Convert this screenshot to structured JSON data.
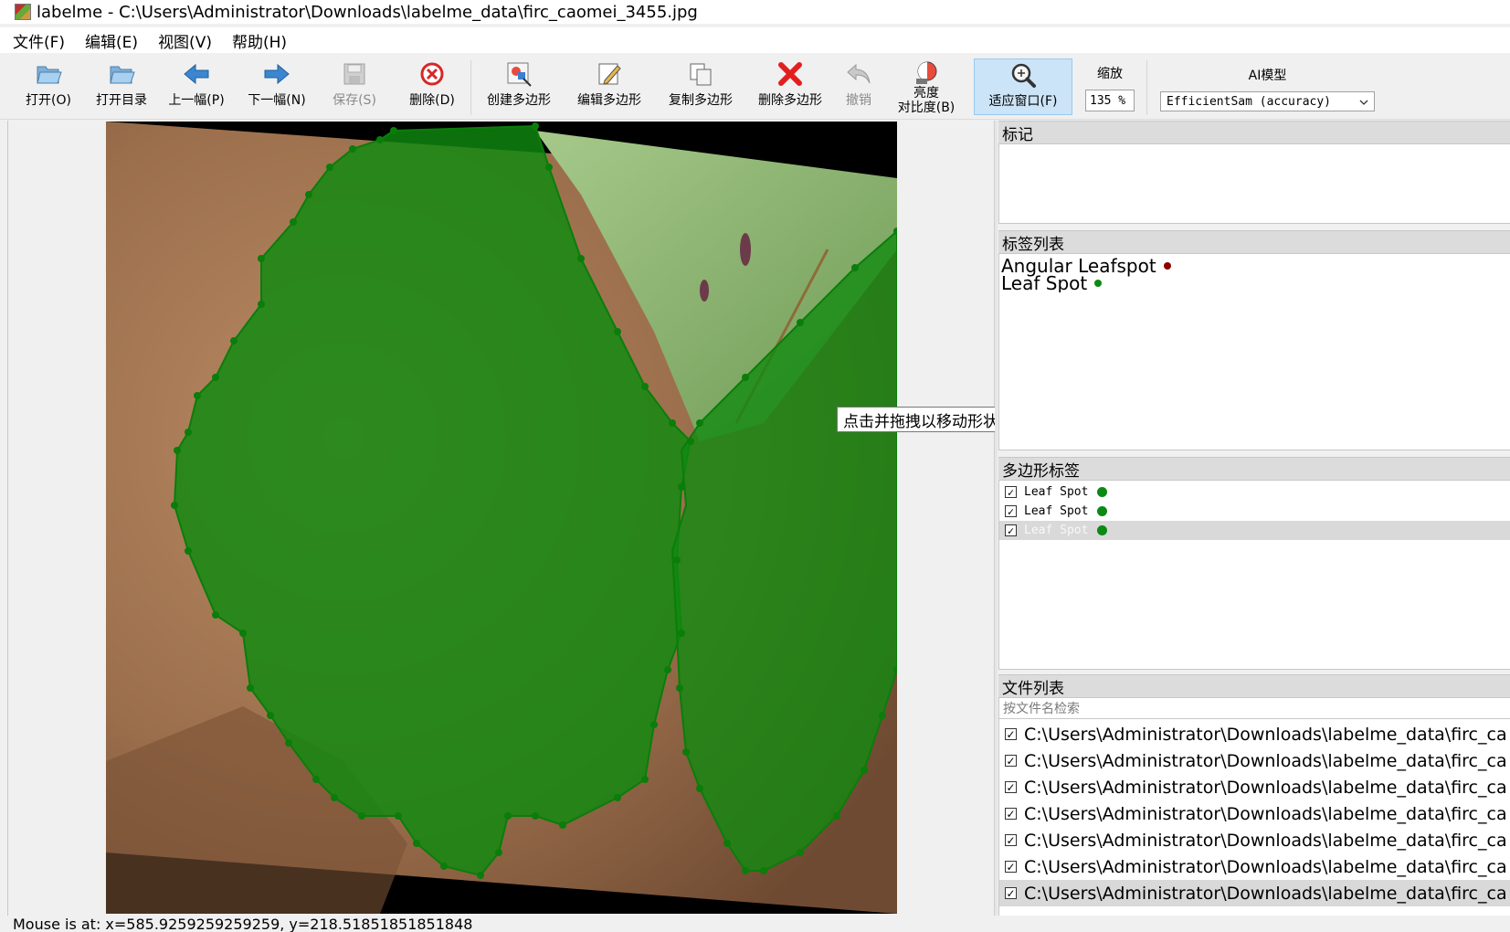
{
  "window": {
    "title": "labelme - C:\\Users\\Administrator\\Downloads\\labelme_data\\firc_caomei_3455.jpg"
  },
  "menu": [
    "文件(F)",
    "编辑(E)",
    "视图(V)",
    "帮助(H)"
  ],
  "toolbar": {
    "open": "打开(O)",
    "open_dir": "打开目录",
    "prev": "上一幅(P)",
    "next": "下一幅(N)",
    "save": "保存(S)",
    "delete": "删除(D)",
    "create_polygon": "创建多边形",
    "edit_polygon": "编辑多边形",
    "copy_polygon": "复制多边形",
    "delete_polygon": "删除多边形",
    "undo": "撤销",
    "brightness_line1": "亮度",
    "brightness_line2": "对比度(B)",
    "fit_window": "适应窗口(F)",
    "zoom_label": "缩放",
    "zoom_value": "135 %",
    "ai_label": "AI模型",
    "ai_model": "EfficientSam (accuracy)"
  },
  "canvas": {
    "tooltip": "点击并拖拽以移动形状'Leaf Spot'"
  },
  "flags_panel": {
    "title": "标记"
  },
  "label_list": {
    "title": "标签列表",
    "items": [
      {
        "name": "Angular Leafspot",
        "color": "#8b0000"
      },
      {
        "name": "Leaf Spot",
        "color": "#0a8a12"
      }
    ]
  },
  "polygon_labels": {
    "title": "多边形标签",
    "items": [
      {
        "name": "Leaf Spot",
        "checked": true,
        "selected": false
      },
      {
        "name": "Leaf Spot",
        "checked": true,
        "selected": false
      },
      {
        "name": "Leaf Spot",
        "checked": true,
        "selected": true
      }
    ],
    "color": "#0a8a12"
  },
  "file_list": {
    "title": "文件列表",
    "search_placeholder": "按文件名检索",
    "items": [
      "C:\\Users\\Administrator\\Downloads\\labelme_data\\firc_ca",
      "C:\\Users\\Administrator\\Downloads\\labelme_data\\firc_ca",
      "C:\\Users\\Administrator\\Downloads\\labelme_data\\firc_ca",
      "C:\\Users\\Administrator\\Downloads\\labelme_data\\firc_ca",
      "C:\\Users\\Administrator\\Downloads\\labelme_data\\firc_ca",
      "C:\\Users\\Administrator\\Downloads\\labelme_data\\firc_ca",
      "C:\\Users\\Administrator\\Downloads\\labelme_data\\firc_ca"
    ],
    "selected_index": 6
  },
  "status": {
    "text": "Mouse is at: x=585.9259259259259, y=218.51851851851848"
  }
}
